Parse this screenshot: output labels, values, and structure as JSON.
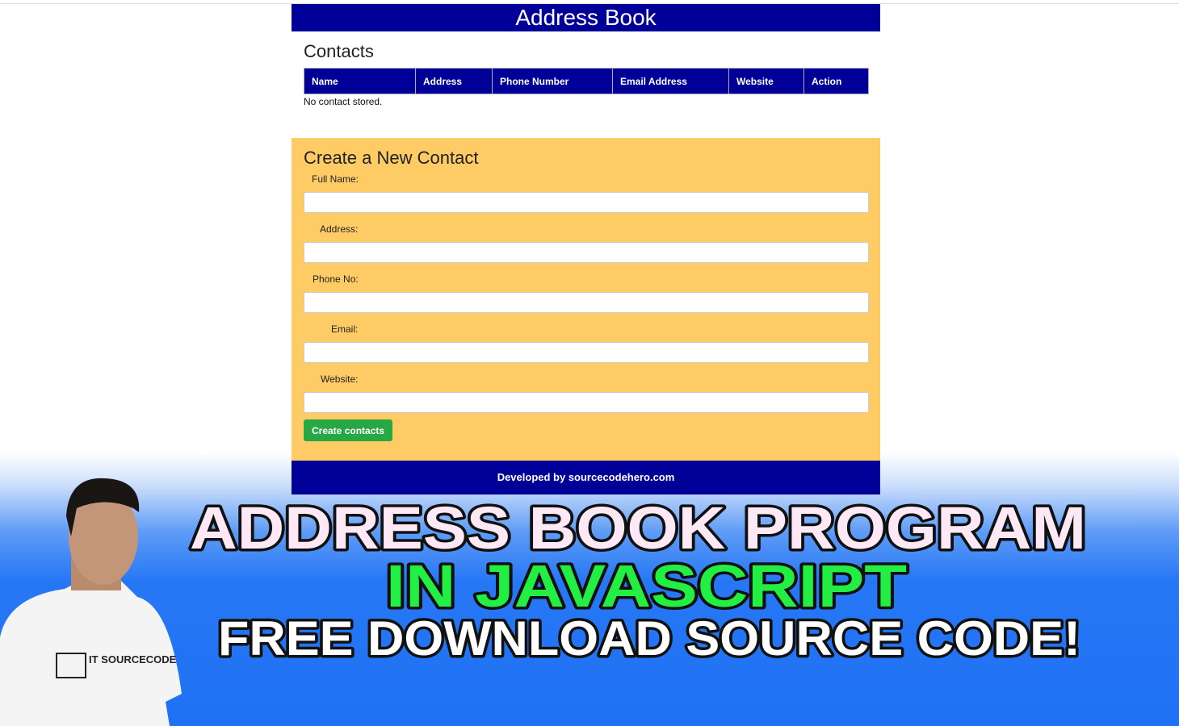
{
  "header": {
    "title": "Address Book"
  },
  "contacts": {
    "heading": "Contacts",
    "columns": [
      "Name",
      "Address",
      "Phone Number",
      "Email Address",
      "Website",
      "Action"
    ],
    "empty_message": "No contact stored."
  },
  "form": {
    "heading": "Create a New Contact",
    "fields": [
      {
        "label": "Full Name:",
        "value": ""
      },
      {
        "label": "Address:",
        "value": ""
      },
      {
        "label": "Phone No:",
        "value": ""
      },
      {
        "label": "Email:",
        "value": ""
      },
      {
        "label": "Website:",
        "value": ""
      }
    ],
    "submit_label": "Create contacts"
  },
  "footer": {
    "text": "Developed by sourcecodehero.com"
  },
  "banner": {
    "line1": "ADDRESS BOOK PROGRAM",
    "line2": "IN JAVASCRIPT",
    "line3": "FREE DOWNLOAD SOURCE CODE!",
    "shirt_logo": "IT SOURCECODE",
    "colors": {
      "line1": "#fde8f6",
      "line2": "#22ee44",
      "line3": "#ffffff",
      "header": "#000099",
      "form_bg": "#fecb65",
      "button": "#28a745"
    }
  }
}
